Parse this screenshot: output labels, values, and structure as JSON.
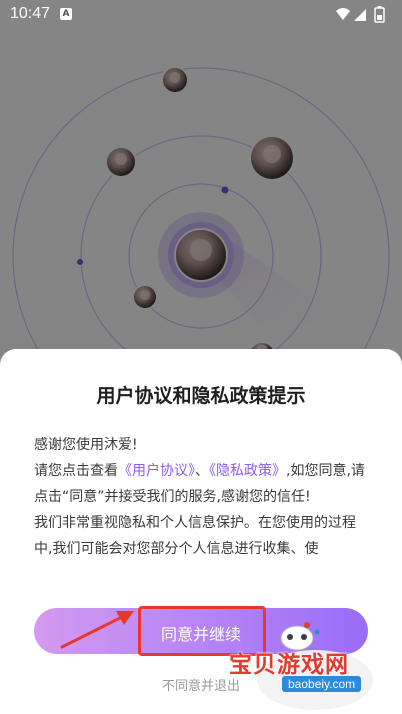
{
  "status_bar": {
    "time": "10:47",
    "notification_badge": "A",
    "icons": [
      "wifi-icon",
      "signal-icon",
      "battery-icon"
    ]
  },
  "dialog": {
    "title": "用户协议和隐私政策提示",
    "greeting": "感谢您使用沐爱!",
    "para1_prefix": "请您点击查看",
    "user_agreement_link": "《用户协议》",
    "separator": "、",
    "privacy_policy_link": "《隐私政策》",
    "para1_suffix": ",如您同意,请点击“同意”并接受我们的服务,感谢您的信任!",
    "para2": "我们非常重视隐私和个人信息保护。在您使用的过程中,我们可能会对您部分个人信息进行收集、使",
    "agree_button": "同意并继续",
    "disagree_button": "不同意并退出"
  },
  "watermark": {
    "title": "宝贝游戏网",
    "url": "baobeiy.com"
  },
  "colors": {
    "link": "#8a5cf5",
    "button_gradient_start": "#d49af0",
    "button_gradient_end": "#9a6cf6",
    "annotation": "#e8382e"
  }
}
